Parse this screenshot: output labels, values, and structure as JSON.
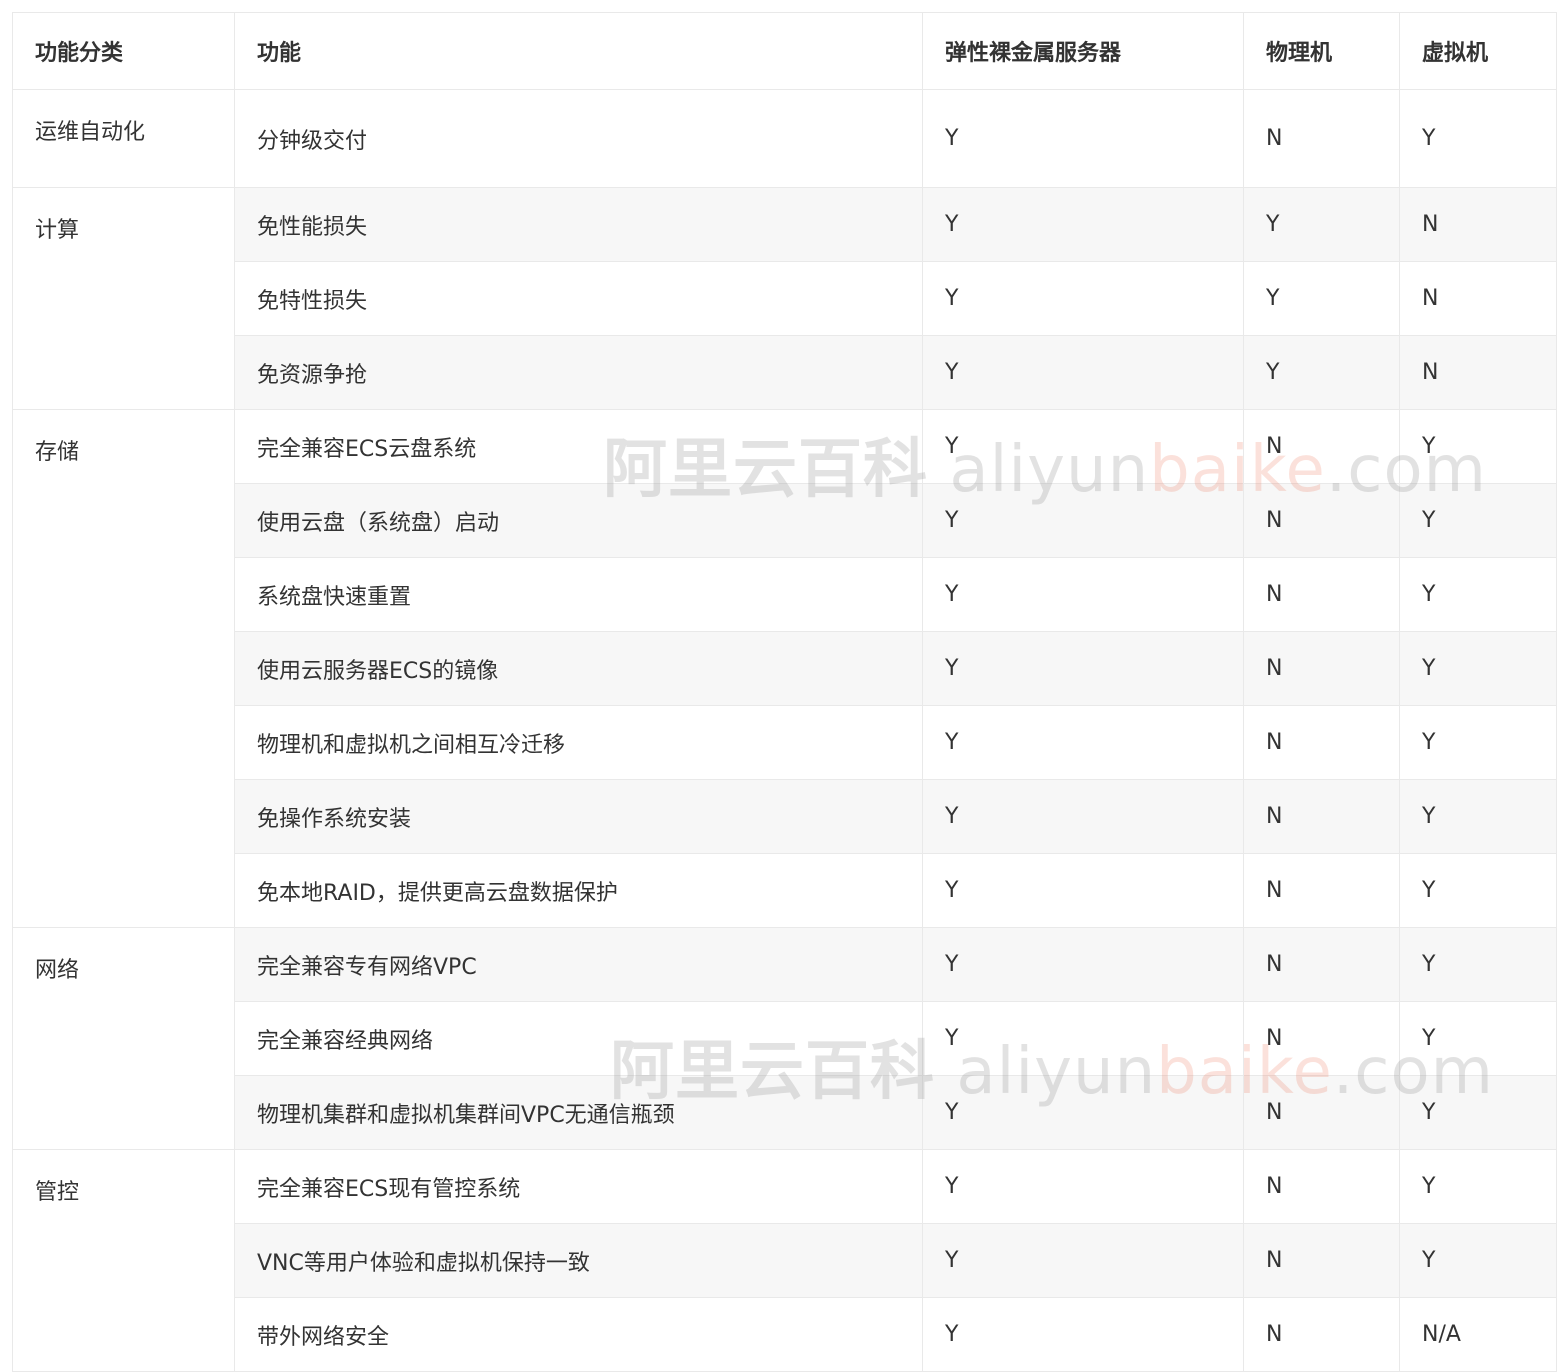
{
  "headers": [
    "功能分类",
    "功能",
    "弹性裸金属服务器",
    "物理机",
    "虚拟机"
  ],
  "groups": [
    {
      "category": "运维自动化",
      "rows": [
        {
          "feature": "分钟级交付",
          "bare_metal": "Y",
          "physical": "N",
          "virtual": "Y"
        }
      ]
    },
    {
      "category": "计算",
      "rows": [
        {
          "feature": "免性能损失",
          "bare_metal": "Y",
          "physical": "Y",
          "virtual": "N"
        },
        {
          "feature": "免特性损失",
          "bare_metal": "Y",
          "physical": "Y",
          "virtual": "N"
        },
        {
          "feature": "免资源争抢",
          "bare_metal": "Y",
          "physical": "Y",
          "virtual": "N"
        }
      ]
    },
    {
      "category": "存储",
      "rows": [
        {
          "feature": "完全兼容ECS云盘系统",
          "bare_metal": "Y",
          "physical": "N",
          "virtual": "Y"
        },
        {
          "feature": "使用云盘（系统盘）启动",
          "bare_metal": "Y",
          "physical": "N",
          "virtual": "Y"
        },
        {
          "feature": "系统盘快速重置",
          "bare_metal": "Y",
          "physical": "N",
          "virtual": "Y"
        },
        {
          "feature": "使用云服务器ECS的镜像",
          "bare_metal": "Y",
          "physical": "N",
          "virtual": "Y"
        },
        {
          "feature": "物理机和虚拟机之间相互冷迁移",
          "bare_metal": "Y",
          "physical": "N",
          "virtual": "Y"
        },
        {
          "feature": "免操作系统安装",
          "bare_metal": "Y",
          "physical": "N",
          "virtual": "Y"
        },
        {
          "feature": "免本地RAID，提供更高云盘数据保护",
          "bare_metal": "Y",
          "physical": "N",
          "virtual": "Y"
        }
      ]
    },
    {
      "category": "网络",
      "rows": [
        {
          "feature": "完全兼容专有网络VPC",
          "bare_metal": "Y",
          "physical": "N",
          "virtual": "Y"
        },
        {
          "feature": "完全兼容经典网络",
          "bare_metal": "Y",
          "physical": "N",
          "virtual": "Y"
        },
        {
          "feature": "物理机集群和虚拟机集群间VPC无通信瓶颈",
          "bare_metal": "Y",
          "physical": "N",
          "virtual": "Y"
        }
      ]
    },
    {
      "category": "管控",
      "rows": [
        {
          "feature": "完全兼容ECS现有管控系统",
          "bare_metal": "Y",
          "physical": "N",
          "virtual": "Y"
        },
        {
          "feature": "VNC等用户体验和虚拟机保持一致",
          "bare_metal": "Y",
          "physical": "N",
          "virtual": "Y"
        },
        {
          "feature": "带外网络安全",
          "bare_metal": "Y",
          "physical": "N",
          "virtual": "N/A"
        }
      ]
    }
  ],
  "watermark": {
    "cn": "阿里云百科",
    "en_part1": "aliyun",
    "en_part2": "baike",
    "en_part3": ".com"
  }
}
